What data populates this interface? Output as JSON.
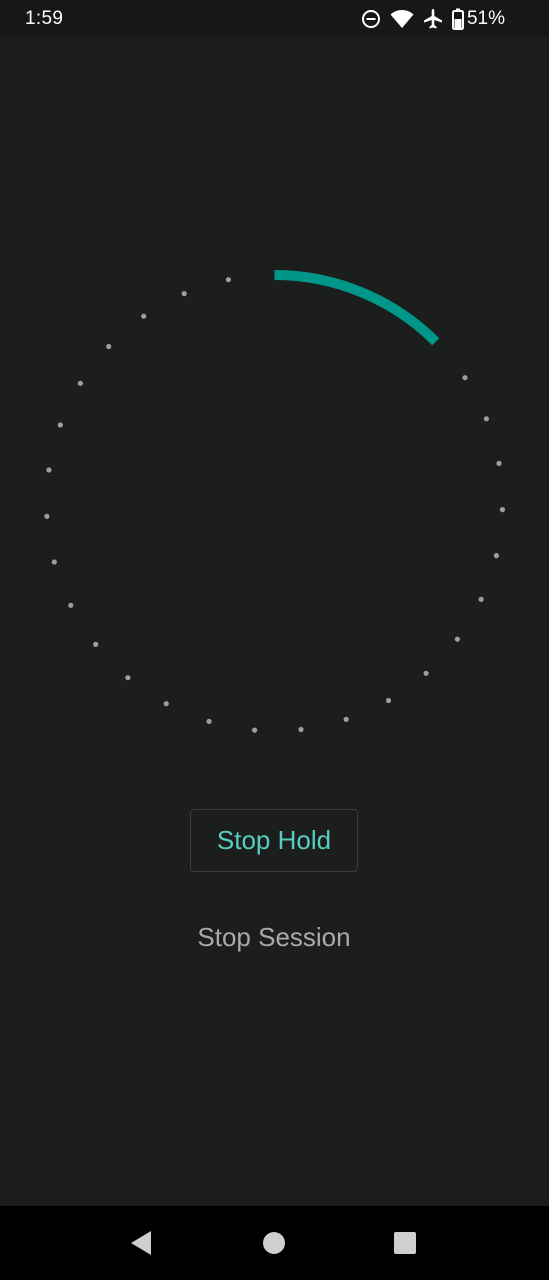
{
  "status_bar": {
    "time": "1:59",
    "battery_percent": "51%",
    "icons": [
      "do-not-disturb-icon",
      "wifi-icon",
      "airplane-mode-icon",
      "battery-icon"
    ]
  },
  "timer": {
    "progress_fraction": 0.125,
    "tick_count": 26,
    "arc_color": "#00968a",
    "tick_color": "#9e9e9e"
  },
  "actions": {
    "stop_hold_label": "Stop Hold",
    "stop_session_label": "Stop Session"
  },
  "colors": {
    "background": "#1c1d1d",
    "accent_text": "#56cfc2",
    "secondary_text": "#a9abab"
  },
  "nav_bar": {
    "icons": [
      "back-icon",
      "home-icon",
      "recents-icon"
    ]
  }
}
